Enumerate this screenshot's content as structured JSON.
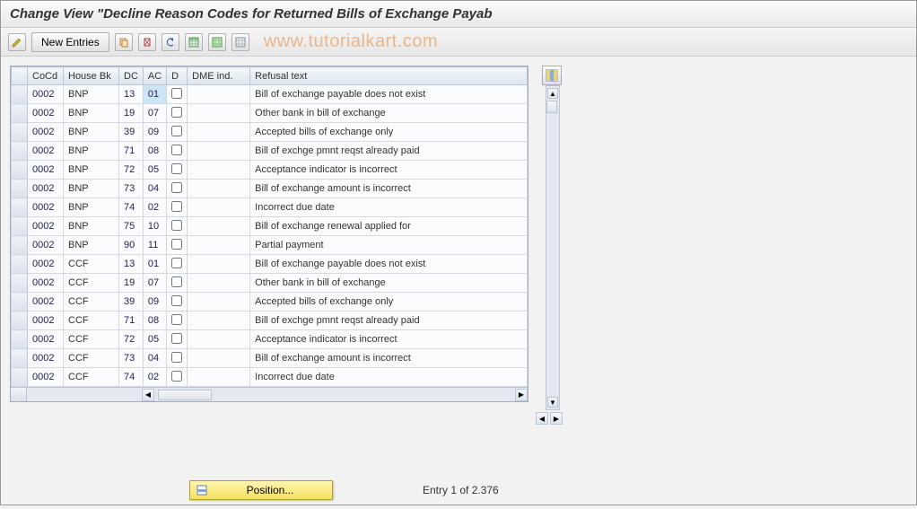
{
  "title": "Change View \"Decline Reason Codes for Returned Bills of Exchange Payab",
  "watermark": "www.tutorialkart.com",
  "toolbar": {
    "new_entries": "New Entries"
  },
  "columns": {
    "rowsel": "",
    "cocd": "CoCd",
    "housebk": "House Bk",
    "dc": "DC",
    "ac": "AC",
    "d": "D",
    "dme": "DME ind.",
    "refusal": "Refusal text"
  },
  "rows": [
    {
      "cocd": "0002",
      "housebk": "BNP",
      "dc": "13",
      "ac": "01",
      "refusal": "Bill of exchange payable does not exist"
    },
    {
      "cocd": "0002",
      "housebk": "BNP",
      "dc": "19",
      "ac": "07",
      "refusal": "Other bank in bill of exchange"
    },
    {
      "cocd": "0002",
      "housebk": "BNP",
      "dc": "39",
      "ac": "09",
      "refusal": "Accepted bills of exchange only"
    },
    {
      "cocd": "0002",
      "housebk": "BNP",
      "dc": "71",
      "ac": "08",
      "refusal": "Bill of exchge pmnt reqst already paid"
    },
    {
      "cocd": "0002",
      "housebk": "BNP",
      "dc": "72",
      "ac": "05",
      "refusal": "Acceptance indicator is incorrect"
    },
    {
      "cocd": "0002",
      "housebk": "BNP",
      "dc": "73",
      "ac": "04",
      "refusal": "Bill of exchange amount is incorrect"
    },
    {
      "cocd": "0002",
      "housebk": "BNP",
      "dc": "74",
      "ac": "02",
      "refusal": "Incorrect due date"
    },
    {
      "cocd": "0002",
      "housebk": "BNP",
      "dc": "75",
      "ac": "10",
      "refusal": "Bill of exchange renewal applied for"
    },
    {
      "cocd": "0002",
      "housebk": "BNP",
      "dc": "90",
      "ac": "11",
      "refusal": "Partial payment"
    },
    {
      "cocd": "0002",
      "housebk": "CCF",
      "dc": "13",
      "ac": "01",
      "refusal": "Bill of exchange payable does not exist"
    },
    {
      "cocd": "0002",
      "housebk": "CCF",
      "dc": "19",
      "ac": "07",
      "refusal": "Other bank in bill of exchange"
    },
    {
      "cocd": "0002",
      "housebk": "CCF",
      "dc": "39",
      "ac": "09",
      "refusal": "Accepted bills of exchange only"
    },
    {
      "cocd": "0002",
      "housebk": "CCF",
      "dc": "71",
      "ac": "08",
      "refusal": "Bill of exchge pmnt reqst already paid"
    },
    {
      "cocd": "0002",
      "housebk": "CCF",
      "dc": "72",
      "ac": "05",
      "refusal": "Acceptance indicator is incorrect"
    },
    {
      "cocd": "0002",
      "housebk": "CCF",
      "dc": "73",
      "ac": "04",
      "refusal": "Bill of exchange amount is incorrect"
    },
    {
      "cocd": "0002",
      "housebk": "CCF",
      "dc": "74",
      "ac": "02",
      "refusal": "Incorrect due date"
    }
  ],
  "selected_row": 0,
  "footer": {
    "position_btn": "Position...",
    "entry_status": "Entry 1 of 2.376"
  }
}
